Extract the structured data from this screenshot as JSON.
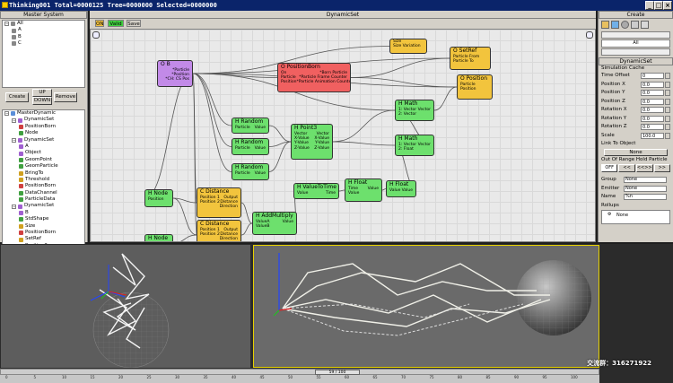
{
  "titlebar": {
    "text": "Thinking001  Total=0000125  Tree=0000000  Selected=0000000"
  },
  "master": {
    "title": "Master System",
    "tree": [
      {
        "label": "All",
        "level": 0
      },
      {
        "label": "A",
        "level": 1
      },
      {
        "label": "B",
        "level": 1
      },
      {
        "label": "C",
        "level": 1
      }
    ],
    "buttons": {
      "create": "Create",
      "up": "UP",
      "down": "DOWN",
      "remove": "Remove"
    }
  },
  "dyntree": [
    {
      "label": "MasterDynamic",
      "level": 0,
      "color": "#5a8ed8"
    },
    {
      "label": "DynamicSet",
      "level": 1,
      "color": "#a060d0"
    },
    {
      "label": "PositionBorn",
      "level": 2,
      "color": "#d04040"
    },
    {
      "label": "Node",
      "level": 2,
      "color": "#40a040"
    },
    {
      "label": "DynamicSet",
      "level": 1,
      "color": "#a060d0"
    },
    {
      "label": "A",
      "level": 2,
      "color": "#a060d0"
    },
    {
      "label": "Object",
      "level": 2,
      "color": "#a060d0"
    },
    {
      "label": "GeomPoint",
      "level": 2,
      "color": "#40a040"
    },
    {
      "label": "GeomParticle",
      "level": 2,
      "color": "#40a040"
    },
    {
      "label": "BringTo",
      "level": 2,
      "color": "#d0a020"
    },
    {
      "label": "Threshold",
      "level": 2,
      "color": "#d0a020"
    },
    {
      "label": "PositionBorn",
      "level": 2,
      "color": "#d04040"
    },
    {
      "label": "DataChannel",
      "level": 2,
      "color": "#40a040"
    },
    {
      "label": "ParticleData",
      "level": 2,
      "color": "#40a040"
    },
    {
      "label": "DynamicSet",
      "level": 1,
      "color": "#a060d0"
    },
    {
      "label": "B",
      "level": 2,
      "color": "#a060d0"
    },
    {
      "label": "StdShape",
      "level": 2,
      "color": "#40a040"
    },
    {
      "label": "Size",
      "level": 2,
      "color": "#d0a020"
    },
    {
      "label": "PositionBorn",
      "level": 2,
      "color": "#d04040"
    },
    {
      "label": "SetRef",
      "level": 2,
      "color": "#d0a020"
    },
    {
      "label": "Position3",
      "level": 2,
      "color": "#40a040"
    },
    {
      "label": "C",
      "level": 2,
      "color": "#a060d0"
    }
  ],
  "editor": {
    "title": "DynamicSet",
    "toolbar": {
      "on": "ON",
      "valid": "Valid",
      "save": "Save"
    },
    "nodes": [
      {
        "id": "ob",
        "title": "O B",
        "color": "p",
        "rows": [
          [
            "",
            "*Particle"
          ],
          [
            "",
            "*Position"
          ],
          [
            "",
            "*CH: CS Pos"
          ]
        ]
      },
      {
        "id": "pborn",
        "title": "O PositionBorn",
        "color": "r",
        "rows": [
          [
            "On",
            "*Born Particle"
          ],
          [
            "Particle",
            "*Particle Frame Counter"
          ],
          [
            "Position",
            "*Particle Animation Counter"
          ]
        ]
      },
      {
        "id": "size",
        "title": "",
        "color": "y",
        "rows": [
          [
            "Size",
            ""
          ],
          [
            "Size Variation",
            ""
          ]
        ]
      },
      {
        "id": "setref",
        "title": "O SetRef",
        "color": "y",
        "rows": [
          [
            "Particle From",
            ""
          ],
          [
            "Particle To",
            ""
          ]
        ]
      },
      {
        "id": "opos",
        "title": "O Position",
        "color": "y",
        "rows": [
          [
            "Particle",
            ""
          ],
          [
            "Position",
            ""
          ]
        ]
      },
      {
        "id": "hmath1",
        "title": "H Math",
        "color": "g",
        "rows": [
          [
            "1: Vector",
            "Vector"
          ],
          [
            "2: Vector",
            ""
          ]
        ]
      },
      {
        "id": "hmath2",
        "title": "H Math",
        "color": "g",
        "rows": [
          [
            "1: Vector",
            "Vector"
          ],
          [
            "2: Float",
            ""
          ]
        ]
      },
      {
        "id": "hrand1",
        "title": "H Random",
        "color": "g",
        "rows": [
          [
            "Particle",
            "Value"
          ]
        ]
      },
      {
        "id": "hrand2",
        "title": "H Random",
        "color": "g",
        "rows": [
          [
            "Particle",
            "Value"
          ]
        ]
      },
      {
        "id": "hrand3",
        "title": "H Random",
        "color": "g",
        "rows": [
          [
            "Particle",
            "Value"
          ]
        ]
      },
      {
        "id": "hpoint3",
        "title": "H Point3",
        "color": "g",
        "rows": [
          [
            "Vector",
            "Vector"
          ],
          [
            "X-Value",
            "X-Value"
          ],
          [
            "Y-Value",
            "Y-Value"
          ],
          [
            "Z-Value",
            "Z-Value"
          ]
        ]
      },
      {
        "id": "hvtt",
        "title": "H ValueToTime",
        "color": "g",
        "rows": [
          [
            "Value",
            "Time"
          ]
        ]
      },
      {
        "id": "hfloat1",
        "title": "H Float",
        "color": "g",
        "rows": [
          [
            "Time",
            "Value"
          ],
          [
            "Value",
            ""
          ]
        ]
      },
      {
        "id": "hfloat2",
        "title": "H Float",
        "color": "g",
        "rows": [
          [
            "Value",
            "Value"
          ]
        ]
      },
      {
        "id": "hnode1",
        "title": "H Node",
        "color": "g",
        "rows": [
          [
            "Position",
            ""
          ]
        ]
      },
      {
        "id": "hnode2",
        "title": "H Node",
        "color": "g",
        "rows": [
          [
            "Position",
            ""
          ]
        ]
      },
      {
        "id": "cdist1",
        "title": "C Distance",
        "color": "y",
        "rows": [
          [
            "Position 1",
            "Output"
          ],
          [
            "Position 2",
            "Distance"
          ],
          [
            "",
            "Direction"
          ]
        ]
      },
      {
        "id": "cdist2",
        "title": "C Distance",
        "color": "y",
        "rows": [
          [
            "Position 1",
            "Output"
          ],
          [
            "Position 2",
            "Distance"
          ],
          [
            "",
            "Direction"
          ]
        ]
      },
      {
        "id": "haddm",
        "title": "H AddMultiply",
        "color": "g",
        "rows": [
          [
            "ValueA",
            "Value"
          ],
          [
            "ValueB",
            ""
          ]
        ]
      }
    ]
  },
  "panel": {
    "create_label": "Create",
    "dropdown_value": "All",
    "section_title": "DynamicSet",
    "cache_label": "Simulation Cache",
    "fields": [
      {
        "label": "Time Offset",
        "value": "0"
      },
      {
        "label": "Position X",
        "value": "0.0"
      },
      {
        "label": "Position Y",
        "value": "0.0"
      },
      {
        "label": "Position Z",
        "value": "0.0"
      },
      {
        "label": "Rotation X",
        "value": "0.0"
      },
      {
        "label": "Rotation Y",
        "value": "0.0"
      },
      {
        "label": "Rotation Z",
        "value": "0.0"
      },
      {
        "label": "Scale",
        "value": "100.0"
      }
    ],
    "link_label": "Link To Object",
    "link_value": "None",
    "oor_label": "Out Of Range Hold Particle",
    "oor_buttons": [
      "OFF",
      "<<",
      "<<>>",
      ">>"
    ],
    "group_label": "Group",
    "group_value": "None",
    "emitter_label": "Emitter",
    "emitter_value": "None",
    "name_label": "Name",
    "name_value": "%n",
    "rollups_label": "Rollups",
    "rollup_item": "None"
  },
  "timeline": {
    "frame": "59 / 100",
    "ticks": [
      "0",
      "5",
      "10",
      "15",
      "20",
      "25",
      "30",
      "35",
      "40",
      "45",
      "50",
      "55",
      "60",
      "65",
      "70",
      "75",
      "80",
      "85",
      "90",
      "95",
      "100"
    ]
  },
  "watermark": "交流群：316271922"
}
